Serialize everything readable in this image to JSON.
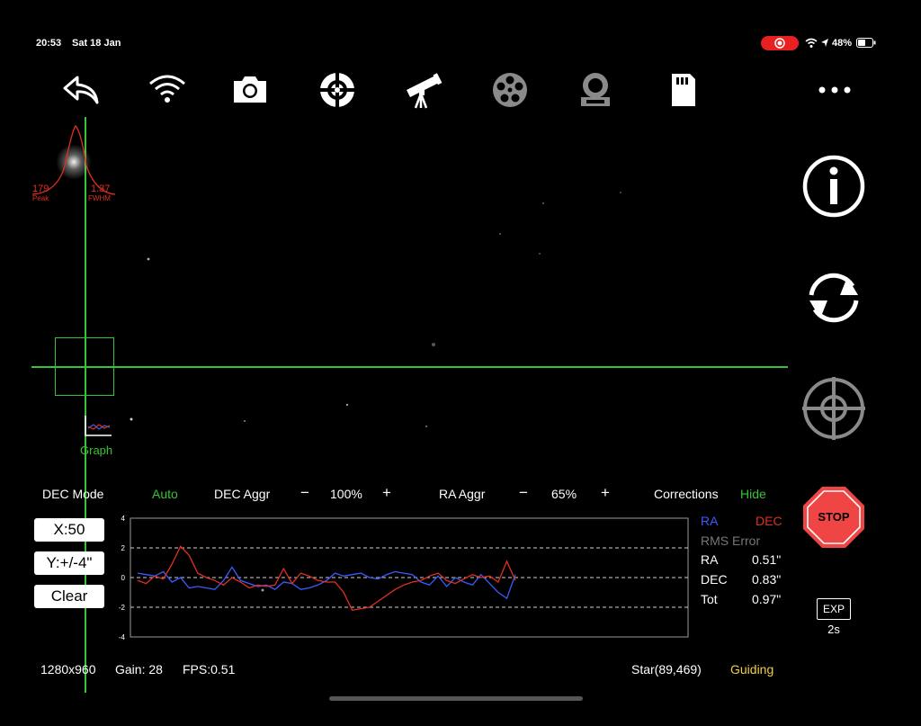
{
  "status": {
    "time": "20:53",
    "date": "Sat 18 Jan",
    "battery": "48%"
  },
  "colors": {
    "green": "#37c337",
    "ra": "#3b5bff",
    "dec": "#e03020",
    "stop": "#f04545",
    "guiding": "#f0d040"
  },
  "toolbar": [
    "back-icon",
    "wifi-icon",
    "camera-icon",
    "guide-target-icon",
    "telescope-icon",
    "filter-wheel-icon",
    "focuser-icon",
    "sd-card-icon",
    "more-icon"
  ],
  "star_profile": {
    "peak_value": "179",
    "peak_label": "Peak",
    "fwhm_value": "1.37",
    "fwhm_label": "FWHM"
  },
  "graph_toggle": {
    "label": "Graph"
  },
  "side": {
    "stop_label": "STOP",
    "exp_label": "EXP",
    "exp_value": "2s"
  },
  "controls": {
    "dec_mode_label": "DEC Mode",
    "dec_mode_value": "Auto",
    "dec_aggr_label": "DEC Aggr",
    "minus": "−",
    "plus": "+",
    "dec_aggr_value": "100%",
    "ra_aggr_label": "RA Aggr",
    "ra_aggr_value": "65%",
    "corrections_label": "Corrections",
    "corrections_toggle": "Hide"
  },
  "graph_buttons": {
    "x_scale": "X:50",
    "y_scale": "Y:+/-4\"",
    "clear": "Clear"
  },
  "stats": {
    "ra_label": "RA",
    "dec_label": "DEC",
    "rms_label": "RMS Error",
    "rows": [
      {
        "label": "RA",
        "value": "0.51\""
      },
      {
        "label": "DEC",
        "value": "0.83\""
      },
      {
        "label": "Tot",
        "value": "0.97\""
      }
    ]
  },
  "footer": {
    "resolution": "1280x960",
    "gain": "Gain: 28",
    "fps": "FPS:0.51",
    "star": "Star(89,469)",
    "state": "Guiding"
  },
  "chart_data": {
    "type": "line",
    "y_ticks": [
      "4",
      "2",
      "0",
      "-2",
      "-4"
    ],
    "ylim": [
      -4,
      4
    ],
    "x": [
      1,
      2,
      3,
      4,
      5,
      6,
      7,
      8,
      9,
      10,
      11,
      12,
      13,
      14,
      15,
      16,
      17,
      18,
      19,
      20,
      21,
      22,
      23,
      24,
      25,
      26,
      27,
      28,
      29,
      30,
      31,
      32,
      33,
      34,
      35,
      36,
      37,
      38,
      39,
      40,
      41,
      42,
      43,
      44,
      45
    ],
    "series": [
      {
        "name": "RA",
        "color": "#3b5bff",
        "values": [
          0.3,
          0.2,
          0.1,
          0.4,
          -0.3,
          0.0,
          -0.7,
          -0.6,
          -0.7,
          -0.8,
          -0.2,
          0.7,
          -0.2,
          -0.4,
          -0.6,
          -0.5,
          -0.8,
          -0.3,
          -0.4,
          -0.8,
          -0.7,
          -0.5,
          -0.2,
          0.3,
          0.1,
          0.2,
          0.3,
          0.0,
          -0.1,
          0.2,
          0.4,
          0.3,
          0.2,
          -0.3,
          -0.5,
          0.1,
          -0.6,
          0.0,
          -0.3,
          -0.5,
          0.2,
          -0.4,
          -1.0,
          -1.4,
          0.2
        ]
      },
      {
        "name": "DEC",
        "color": "#e03020",
        "values": [
          -0.2,
          -0.4,
          0.1,
          -0.1,
          0.9,
          2.1,
          1.5,
          0.3,
          0.0,
          -0.2,
          -0.5,
          0.0,
          -0.3,
          -0.7,
          -0.5,
          -0.6,
          -0.5,
          0.6,
          -0.4,
          0.3,
          0.1,
          -0.2,
          -0.3,
          -0.3,
          -1.0,
          -2.2,
          -2.1,
          -2.0,
          -1.6,
          -1.2,
          -0.8,
          -0.5,
          -0.3,
          -0.2,
          0.1,
          0.3,
          -0.2,
          -0.4,
          -0.1,
          0.2,
          0.0,
          0.1,
          -0.3,
          1.1,
          -0.2
        ]
      }
    ]
  }
}
